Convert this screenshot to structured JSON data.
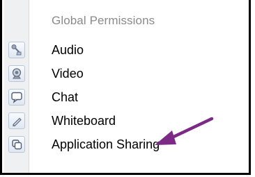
{
  "panel": {
    "header": "Global Permissions",
    "items": [
      {
        "label": "Audio",
        "icon": "microphone-icon"
      },
      {
        "label": "Video",
        "icon": "webcam-icon"
      },
      {
        "label": "Chat",
        "icon": "chat-bubble-icon"
      },
      {
        "label": "Whiteboard",
        "icon": "pencil-icon"
      },
      {
        "label": "Application Sharing",
        "icon": "app-sharing-icon"
      }
    ]
  },
  "annotation": {
    "arrow_color": "#7b2a86"
  }
}
